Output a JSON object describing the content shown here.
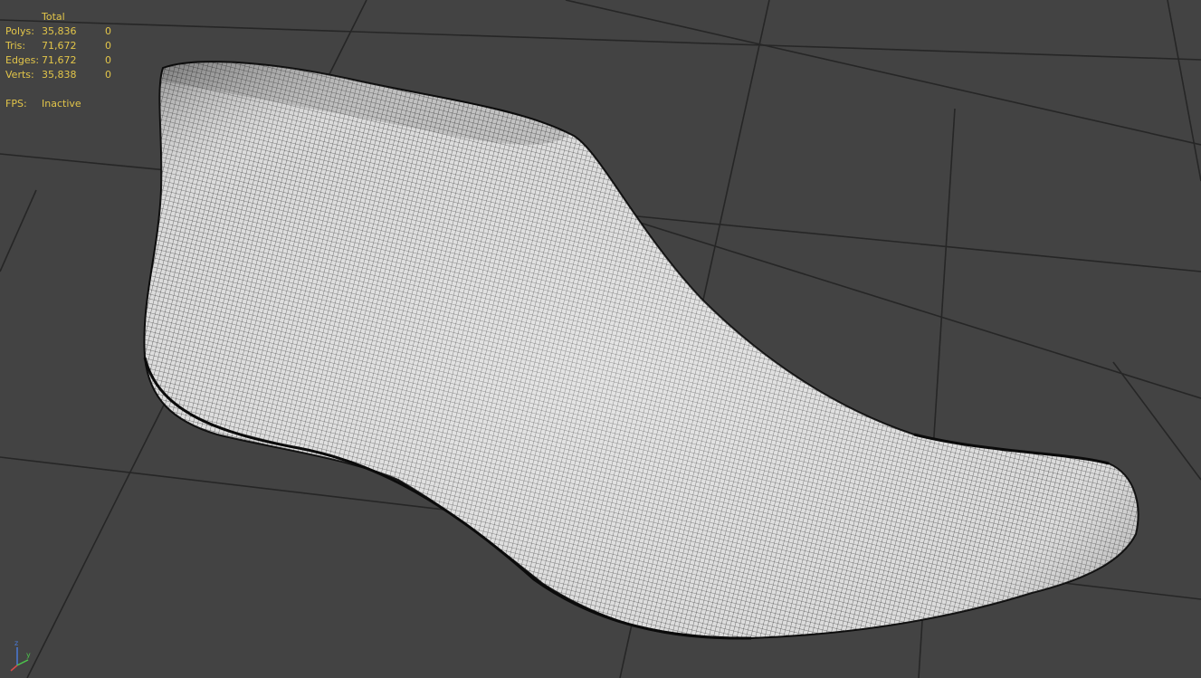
{
  "viewport": {
    "background": "#434343",
    "grid_color": "#232323",
    "mesh_fill": "#d8d8d8",
    "mesh_wire": "#111111",
    "stats_color": "#e2c54a",
    "statistics": {
      "header": "Total",
      "rows": [
        {
          "label": "Polys:",
          "total": "35,836",
          "selected": "0"
        },
        {
          "label": "Tris:",
          "total": "71,672",
          "selected": "0"
        },
        {
          "label": "Edges:",
          "total": "71,672",
          "selected": "0"
        },
        {
          "label": "Verts:",
          "total": "35,838",
          "selected": "0"
        }
      ],
      "fps_label": "FPS:",
      "fps_value": "Inactive"
    },
    "axis_gizmo": {
      "z_label": "z",
      "y_label": "y",
      "x_label": "x"
    }
  }
}
